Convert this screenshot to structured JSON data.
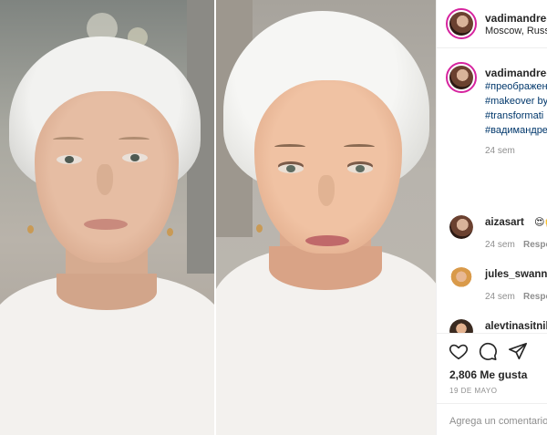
{
  "post": {
    "header": {
      "username": "vadimandreev",
      "location": "Moscow, Russia"
    },
    "caption": {
      "username": "vadimandreev",
      "hashtags": [
        "#преображение",
        "#makeover by",
        "#transformati",
        "#вадимандре"
      ],
      "time": "24 sem"
    },
    "comments": [
      {
        "username": "aizasart",
        "emoji": "😍🙌",
        "time": "24 sem",
        "reply_label": "Respo"
      },
      {
        "username": "jules_swannie",
        "emoji": "",
        "time": "24 sem",
        "reply_label": "Respo"
      },
      {
        "username": "alevtinasitnik",
        "emoji": "",
        "time": "",
        "reply_label": ""
      }
    ],
    "actions": {
      "like_icon": "heart-icon",
      "comment_icon": "comment-icon",
      "share_icon": "send-icon"
    },
    "likes_text": "2,806 Me gusta",
    "date_text": "19 DE MAYO",
    "comment_input_placeholder": "Agrega un comentario"
  },
  "colors": {
    "link": "#00376b",
    "muted": "#8e8e8e",
    "text": "#262626",
    "story_ring": "#d6249f"
  }
}
